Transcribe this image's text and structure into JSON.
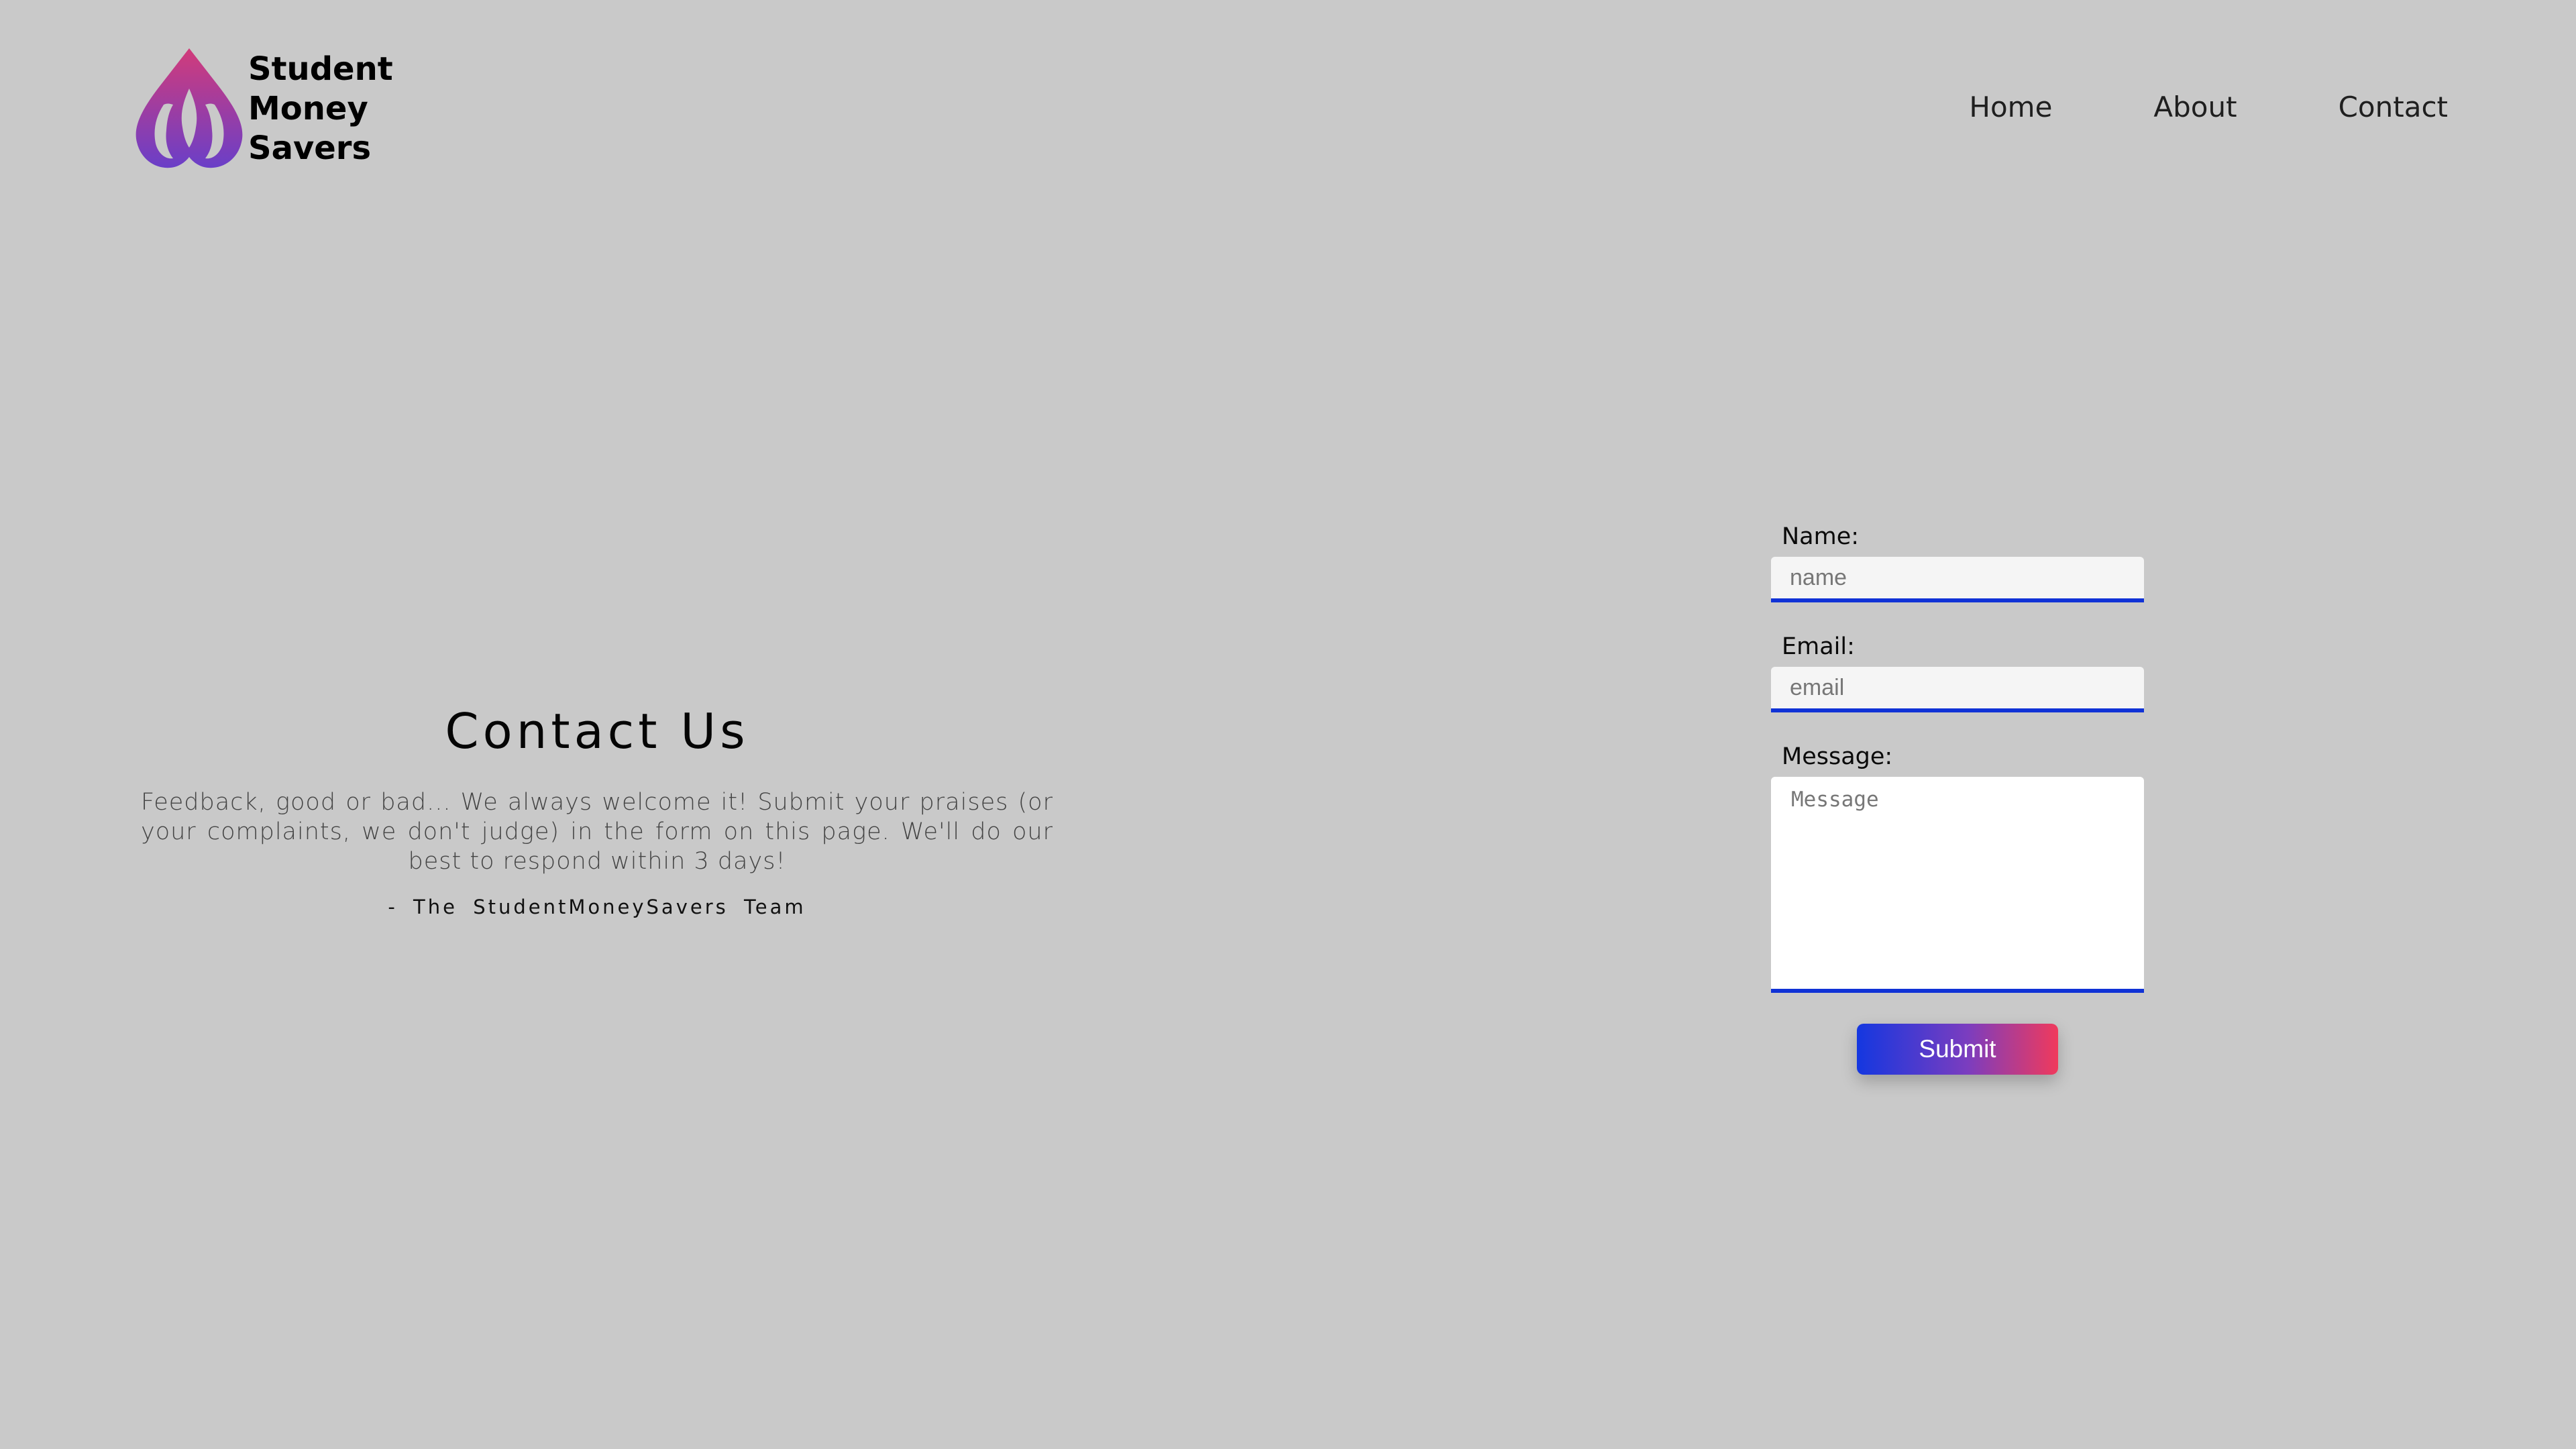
{
  "brand": {
    "name_lines": [
      "Student",
      "Money",
      "Savers"
    ],
    "logo_icon": "flame-drop-logo-icon",
    "gradient": [
      "#d23b7a",
      "#6a3fc8"
    ]
  },
  "nav": {
    "items": [
      "Home",
      "About",
      "Contact"
    ]
  },
  "intro": {
    "title": "Contact Us",
    "body": "Feedback, good or bad... We always welcome it! Submit your praises (or your complaints, we don't judge) in the form on this page. We'll do our best to respond within 3 days!",
    "signature": "- The StudentMoneySavers Team"
  },
  "form": {
    "name_label": "Name:",
    "name_placeholder": "name",
    "email_label": "Email:",
    "email_placeholder": "email",
    "message_label": "Message:",
    "message_placeholder": "Message",
    "submit_label": "Submit",
    "accent_color": "#1032d6"
  },
  "colors": {
    "background": "#c9c9c9",
    "button_gradient": [
      "#1437e0",
      "#f03a5c"
    ]
  }
}
